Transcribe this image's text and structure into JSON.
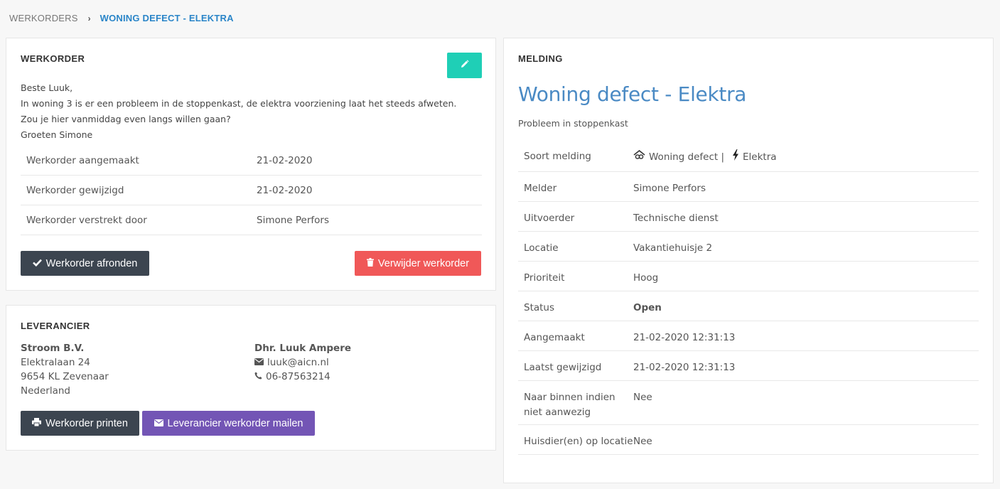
{
  "breadcrumb": {
    "root": "WERKORDERS",
    "separator": "›",
    "current": "WONING DEFECT - ELEKTRA"
  },
  "werkorder": {
    "title": "WERKORDER",
    "message": [
      "Beste Luuk,",
      "In woning 3 is er een probleem in de stoppenkast, de elektra voorziening laat het steeds afweten.",
      "Zou je hier vanmiddag even langs willen gaan?",
      "Groeten Simone"
    ],
    "rows": [
      {
        "label": "Werkorder aangemaakt",
        "value": "21-02-2020"
      },
      {
        "label": "Werkorder gewijzigd",
        "value": "21-02-2020"
      },
      {
        "label": "Werkorder verstrekt door",
        "value": "Simone Perfors"
      }
    ],
    "complete_label": "Werkorder afronden",
    "delete_label": "Verwijder werkorder"
  },
  "leverancier": {
    "title": "LEVERANCIER",
    "company": "Stroom B.V.",
    "street": "Elektralaan 24",
    "city": "9654 KL Zevenaar",
    "country": "Nederland",
    "contact": "Dhr. Luuk Ampere",
    "email": "luuk@aicn.nl",
    "phone": "06-87563214",
    "print_label": "Werkorder printen",
    "mail_label": "Leverancier werkorder mailen"
  },
  "melding": {
    "title": "MELDING",
    "heading": "Woning defect - Elektra",
    "subtitle": "Probleem in stoppenkast",
    "soort_label": "Soort melding",
    "soort_type": "Woning defect |",
    "soort_category": "Elektra",
    "melder_label": "Melder",
    "melder": "Simone Perfors",
    "uitvoerder_label": "Uitvoerder",
    "uitvoerder": "Technische dienst",
    "locatie_label": "Locatie",
    "locatie": "Vakantiehuisje 2",
    "prioriteit_label": "Prioriteit",
    "prioriteit": "Hoog",
    "status_label": "Status",
    "status": "Open",
    "aangemaakt_label": "Aangemaakt",
    "aangemaakt": "21-02-2020 12:31:13",
    "gewijzigd_label": "Laatst gewijzigd",
    "gewijzigd": "21-02-2020 12:31:13",
    "binnen_label": "Naar binnen indien niet aanwezig",
    "binnen": "Nee",
    "huisdier_label": "Huisdier(en) op locatie",
    "huisdier": "Nee"
  },
  "colors": {
    "accent": "#1fcfb6",
    "danger": "#f05858",
    "purple": "#7355b5",
    "dark": "#3c4550",
    "link": "#3b82c4"
  }
}
